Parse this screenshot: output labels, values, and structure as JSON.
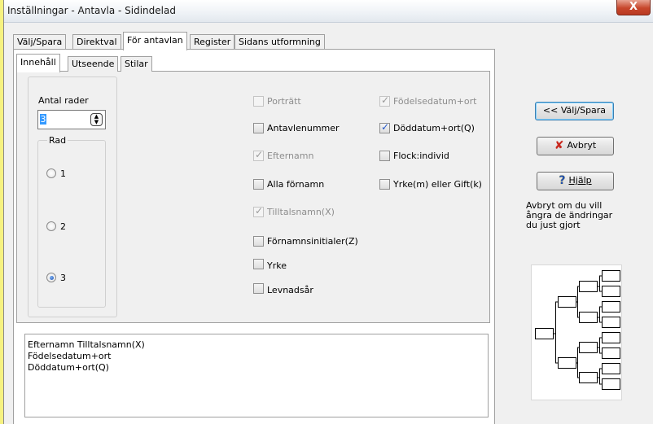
{
  "window": {
    "title": "Inställningar - Antavla - Sidindelad",
    "close_glyph": "X"
  },
  "tabs": [
    {
      "label": "Välj/Spara"
    },
    {
      "label": "Direktval"
    },
    {
      "label": "För antavlan"
    },
    {
      "label": "Register"
    },
    {
      "label": "Sidans utformning"
    }
  ],
  "subtabs": [
    {
      "label": "Innehåll"
    },
    {
      "label": "Utseende"
    },
    {
      "label": "Stilar"
    }
  ],
  "rows": {
    "label": "Antal rader",
    "value": "3",
    "group_label": "Rad",
    "options": [
      "1",
      "2",
      "3"
    ],
    "selected": "3"
  },
  "checkboxes_left": [
    {
      "label": "Porträtt",
      "checked": false,
      "disabled": true
    },
    {
      "label": "Antavlenummer",
      "checked": false,
      "disabled": false
    },
    {
      "label": "Efternamn",
      "checked": true,
      "disabled": true
    },
    {
      "label": "Alla förnamn",
      "checked": false,
      "disabled": false
    },
    {
      "label": "Tilltalsnamn(X)",
      "checked": true,
      "disabled": true
    },
    {
      "label": "Förnamnsinitialer(Z)",
      "checked": false,
      "disabled": false
    },
    {
      "label": "Yrke",
      "checked": false,
      "disabled": false
    },
    {
      "label": "Levnadsår",
      "checked": false,
      "disabled": false
    }
  ],
  "checkboxes_right": [
    {
      "label": "Födelsedatum+ort",
      "checked": true,
      "disabled": true
    },
    {
      "label": "Döddatum+ort(Q)",
      "checked": true,
      "disabled": false
    },
    {
      "label": "Flock:individ",
      "checked": false,
      "disabled": false
    },
    {
      "label": "Yrke(m) eller Gift(k)",
      "checked": false,
      "disabled": false
    }
  ],
  "preview_lines": [
    "Efternamn Tilltalsnamn(X)",
    "Födelsedatum+ort",
    "Döddatum+ort(Q)"
  ],
  "buttons": {
    "back": "<< Välj/Spara",
    "cancel": "Avbryt",
    "help": "Hjälp"
  },
  "help_text": "Avbryt om du vill ångra de ändringar du just gjort",
  "colors": {
    "accent": "#3399ff",
    "cancel_icon": "#c8281e",
    "help_icon": "#e6b800"
  }
}
